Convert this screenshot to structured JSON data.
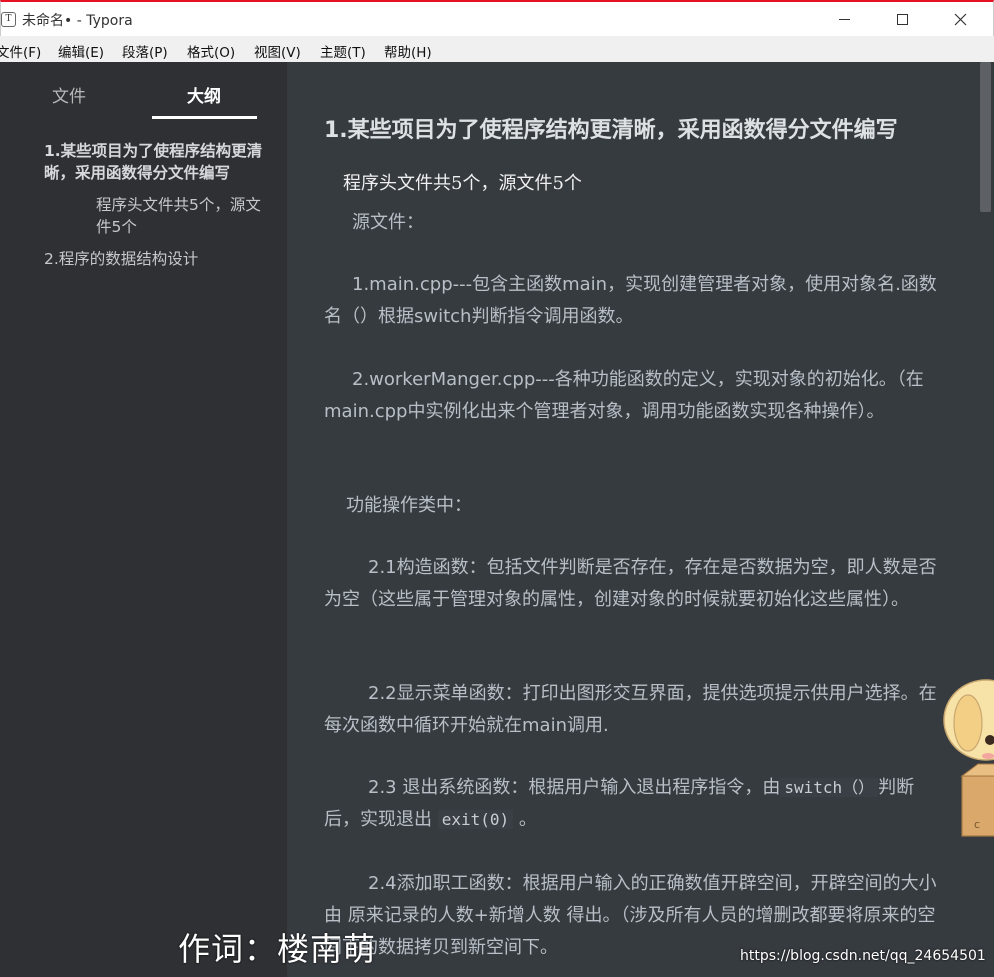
{
  "window": {
    "app_icon": "T",
    "title": "未命名• - Typora",
    "minimize_icon": "minimize-icon",
    "maximize_icon": "maximize-icon",
    "close_icon": "close-icon"
  },
  "menu": [
    {
      "label": "文件(F)"
    },
    {
      "label": "编辑(E)"
    },
    {
      "label": "段落(P)"
    },
    {
      "label": "格式(O)"
    },
    {
      "label": "视图(V)"
    },
    {
      "label": "主题(T)"
    },
    {
      "label": "帮助(H)"
    }
  ],
  "sidebar": {
    "tabs": {
      "files": "文件",
      "outline": "大纲"
    },
    "outline": {
      "h1_a": "1.某些项目为了使程序结构更清晰，采用函数得分文件编写",
      "h2_a": "程序头文件共5个，源文件5个",
      "h1_b": "2.程序的数据结构设计"
    }
  },
  "editor": {
    "heading1": "1.某些项目为了使程序结构更清晰，采用函数得分文件编写",
    "heading2": "程序头文件共5个，源文件5个",
    "p_source_title": "源文件：",
    "p_main": "1.main.cpp---包含主函数main，实现创建管理者对象，使用对象名.函数名（）根据switch判断指令调用函数。",
    "p_worker": "2.workerManger.cpp---各种功能函数的定义，实现对象的初始化。（在main.cpp中实例化出来个管理者对象，调用功能函数实现各种操作）。",
    "p_func_title": "功能操作类中：",
    "p_21": "2.1构造函数：包括文件判断是否存在，存在是否数据为空，即人数是否为空（这些属于管理对象的属性，创建对象的时候就要初始化这些属性）。",
    "p_22": "2.2显示菜单函数：打印出图形交互界面，提供选项提示供用户选择。在每次函数中循环开始就在main调用.",
    "p_23_a": "2.3 退出系统函数：根据用户输入退出程序指令，由",
    "p_23_code1": "switch（）",
    "p_23_b": "判断后，实现退出",
    "p_23_code2": "exit(0)",
    "p_23_c": "。",
    "p_24": "2.4添加职工函数：根据用户输入的正确数值开辟空间，开辟空间的大小由 原来记录的人数+新增人数 得出。（涉及所有人员的增删改都要将原来的空间下的数据拷贝到新空间下。"
  },
  "overlay": {
    "lyric": "作词：楼南萌",
    "watermark": "https://blog.csdn.net/qq_24654501"
  },
  "colors": {
    "sidebar_bg": "#2e3033",
    "editor_bg": "#363b40",
    "text": "#b8bfc6",
    "titlebar_accent": "#e81123"
  }
}
